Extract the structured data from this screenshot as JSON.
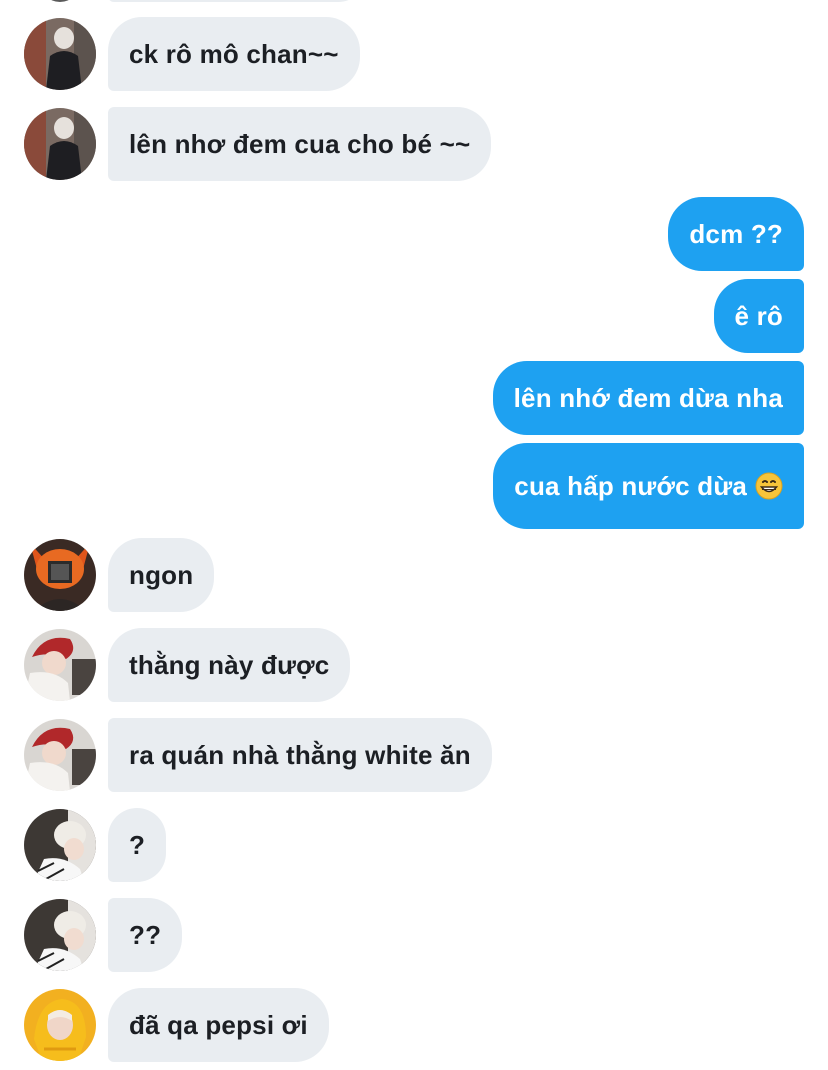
{
  "messages": [
    {
      "direction": "in",
      "text": "ck rô mô chan~~",
      "avatar": "avatar-user-a"
    },
    {
      "direction": "in",
      "text": "lên nhơ đem cua cho bé ~~",
      "avatar": "avatar-user-a"
    },
    {
      "direction": "out",
      "text": "dcm ??"
    },
    {
      "direction": "out",
      "text": "ê rô"
    },
    {
      "direction": "out",
      "text": "lên nhớ đem dừa nha"
    },
    {
      "direction": "out",
      "text": "cua hấp nước dừa",
      "emoji": "grinning-face-emoji"
    },
    {
      "direction": "in",
      "text": "ngon",
      "avatar": "avatar-user-b"
    },
    {
      "direction": "in",
      "text": "thằng này được",
      "avatar": "avatar-user-c"
    },
    {
      "direction": "in",
      "text": "ra quán nhà thằng white ăn",
      "avatar": "avatar-user-c"
    },
    {
      "direction": "in",
      "text": "?",
      "avatar": "avatar-user-d"
    },
    {
      "direction": "in",
      "text": "??",
      "avatar": "avatar-user-d"
    },
    {
      "direction": "in",
      "text": "đã qa pepsi ơi",
      "avatar": "avatar-user-e"
    }
  ],
  "colors": {
    "incoming_bubble": "#e9edf1",
    "outgoing_bubble": "#1ea1f1",
    "incoming_text": "#1c1f24",
    "outgoing_text": "#ffffff"
  }
}
